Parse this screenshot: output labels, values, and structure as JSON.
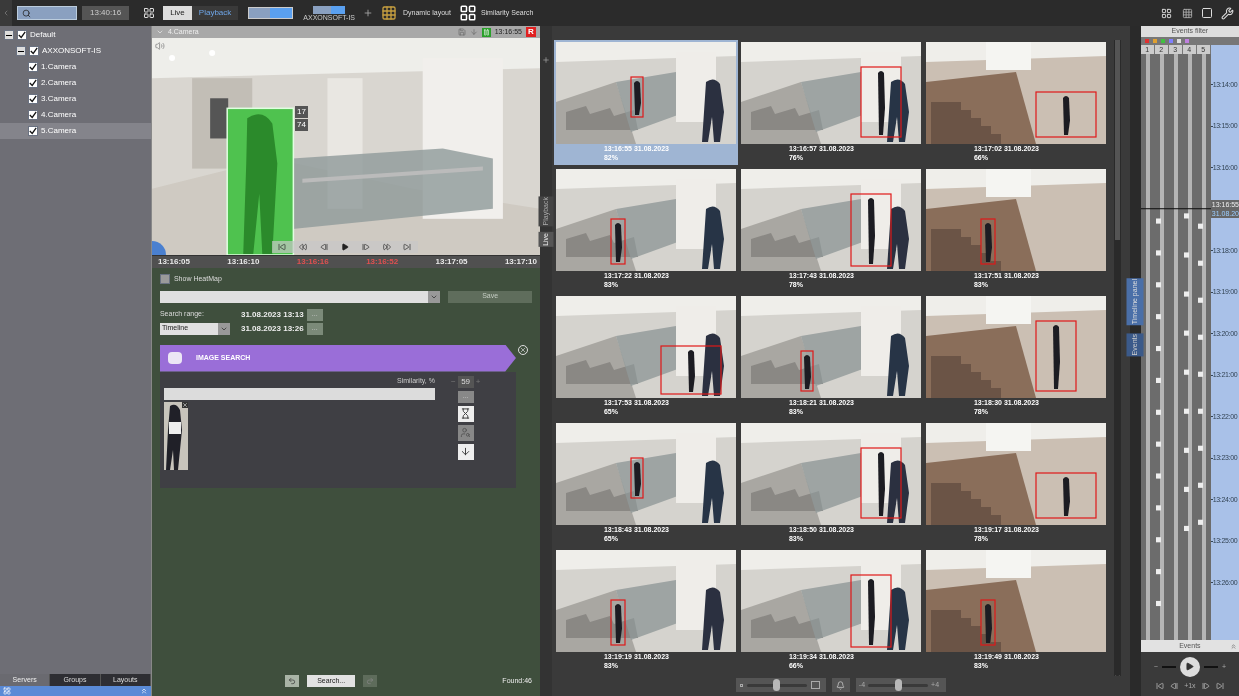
{
  "topbar": {
    "time": "13:40:16",
    "modes": [
      {
        "label": "Live",
        "selected": true
      },
      {
        "label": "Playback",
        "selected": false
      }
    ],
    "layout_caption": "AXXONSOFT-IS",
    "dynamic_layout": "Dynamic layout",
    "similarity_search": "Similarity Search"
  },
  "tree": [
    {
      "label": "Default",
      "checked": true,
      "expanded": true,
      "selected": false,
      "children": [
        {
          "label": "AXXONSOFT-IS",
          "checked": true,
          "expanded": true,
          "selected": false,
          "children": [
            {
              "label": "1.Camera",
              "checked": true,
              "selected": false
            },
            {
              "label": "2.Camera",
              "checked": true,
              "selected": false
            },
            {
              "label": "3.Camera",
              "checked": true,
              "selected": false
            },
            {
              "label": "4.Camera",
              "checked": true,
              "selected": false
            },
            {
              "label": "5.Camera",
              "checked": true,
              "selected": true
            }
          ]
        }
      ]
    }
  ],
  "bottom_tabs": [
    {
      "label": "Servers",
      "selected": true
    },
    {
      "label": "Groups",
      "selected": false
    },
    {
      "label": "Layouts",
      "selected": false
    }
  ],
  "camera": {
    "title": "4.Camera",
    "time": "13:16:55",
    "rec": "R",
    "overlay_values": [
      "17",
      "74"
    ],
    "timeline_labels": [
      {
        "text": "13:16:05",
        "color": "#e8e8e8"
      },
      {
        "text": "13:16:10",
        "color": "#e8e8e8"
      },
      {
        "text": "13:16:16",
        "color": "#e05050"
      },
      {
        "text": "13:16:52",
        "color": "#e05050"
      },
      {
        "text": "13:17:05",
        "color": "#e8e8e8"
      },
      {
        "text": "13:17:10",
        "color": "#e8e8e8"
      }
    ]
  },
  "side_tabs": [
    {
      "label": "Playback",
      "selected": false
    },
    {
      "label": "Live",
      "selected": true
    }
  ],
  "search": {
    "heatmap": {
      "label": "Show HeatMap",
      "checked": false
    },
    "save": {
      "label": "Save",
      "disabled": true
    },
    "range_label": "Search range:",
    "mode": "Timeline",
    "from": "31.08.2023 13:13",
    "to": "31.08.2023 13:26",
    "more": "...",
    "image_search": {
      "title": "IMAGE SEARCH",
      "similarity_label": "Similarity, %",
      "similarity": "59",
      "minus": "−",
      "plus": "+",
      "more": "..."
    },
    "search_button": "Search...",
    "found": "Found:46"
  },
  "results": [
    {
      "time": "13:16:55 31.08.2023",
      "score": "82%",
      "selected": true
    },
    {
      "time": "13:16:57 31.08.2023",
      "score": "76%",
      "selected": false
    },
    {
      "time": "13:17:02 31.08.2023",
      "score": "66%",
      "selected": false
    },
    {
      "time": "13:17:22 31.08.2023",
      "score": "83%",
      "selected": false
    },
    {
      "time": "13:17:43 31.08.2023",
      "score": "78%",
      "selected": false
    },
    {
      "time": "13:17:51 31.08.2023",
      "score": "83%",
      "selected": false
    },
    {
      "time": "13:17:53 31.08.2023",
      "score": "65%",
      "selected": false
    },
    {
      "time": "13:18:21 31.08.2023",
      "score": "83%",
      "selected": false
    },
    {
      "time": "13:18:30 31.08.2023",
      "score": "78%",
      "selected": false
    },
    {
      "time": "13:18:43 31.08.2023",
      "score": "65%",
      "selected": false
    },
    {
      "time": "13:18:50 31.08.2023",
      "score": "83%",
      "selected": false
    },
    {
      "time": "13:19:17 31.08.2023",
      "score": "78%",
      "selected": false
    },
    {
      "time": "13:19:19 31.08.2023",
      "score": "83%",
      "selected": false
    },
    {
      "time": "13:19:34 31.08.2023",
      "score": "66%",
      "selected": false
    },
    {
      "time": "13:19:49 31.08.2023",
      "score": "83%",
      "selected": false
    }
  ],
  "bottom_controls": {
    "size_slider": {
      "level": 0.5
    },
    "offset_slider": {
      "level": 0.5,
      "min": "-4",
      "max": "+4"
    }
  },
  "panel_tabs": [
    {
      "label": "Timeline panel",
      "selected": true
    },
    {
      "label": "Events",
      "selected": false
    }
  ],
  "events": {
    "title": "Events filter",
    "lanes": [
      "1",
      "2",
      "3",
      "4",
      "5"
    ],
    "ruler": [
      "13:14:00",
      "13:15:00",
      "13:16:00",
      "13:18:00",
      "13:19:00",
      "13:20:00",
      "13:21:00",
      "13:22:00",
      "13:23:00",
      "13:24:00",
      "13:25:00",
      "13:26:00"
    ],
    "current_time": "13:16:55",
    "current_date": "31.08.20",
    "footer": "Events",
    "speed": "+1x",
    "minus": "−",
    "plus": "+"
  }
}
